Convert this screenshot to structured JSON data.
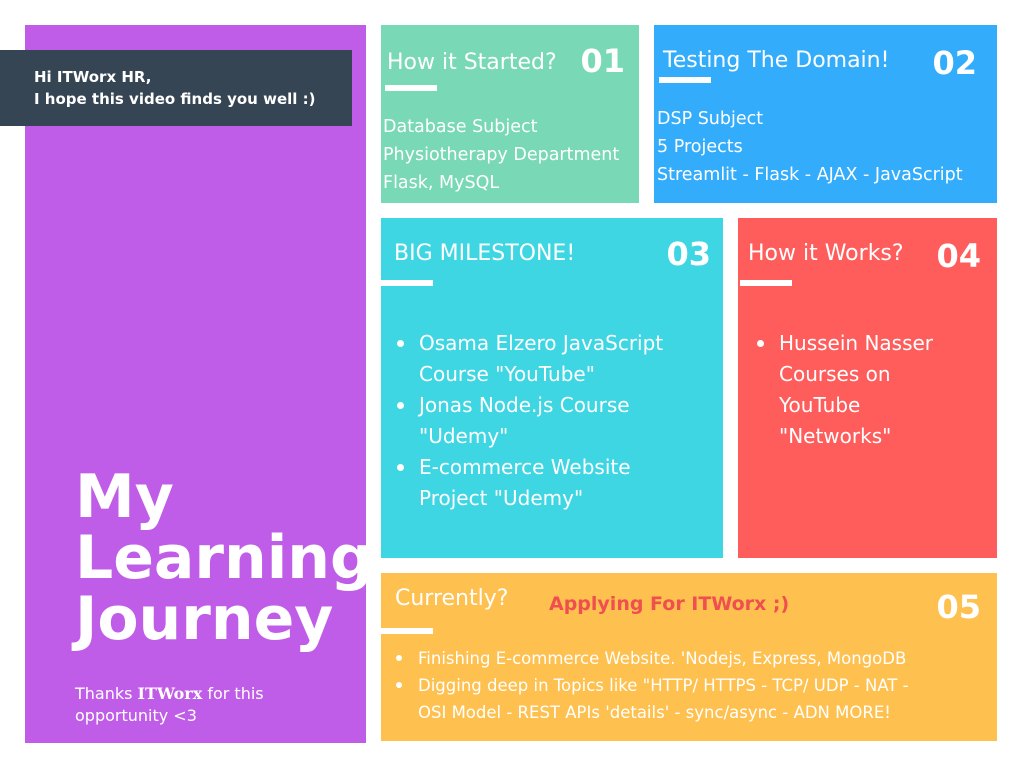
{
  "greeting": {
    "line1": "Hi ITWorx HR,",
    "line2": "I hope this video finds you well :)"
  },
  "left": {
    "title_lines": [
      "My",
      "Learning",
      "Journey"
    ],
    "thanks_prefix": "Thanks ",
    "thanks_brand": "ITWorx",
    "thanks_suffix": " for this",
    "thanks_line2": "opportunity <3",
    "bg": "#c05de8"
  },
  "panels": {
    "p1": {
      "title": "How it Started?",
      "number": "01",
      "lines": [
        "Database Subject",
        "Physiotherapy Department",
        "Flask, MySQL"
      ],
      "bg": "#79d8b6"
    },
    "p2": {
      "title": "Testing The Domain!",
      "number": "02",
      "lines": [
        "DSP Subject",
        "5 Projects",
        "Streamlit - Flask - AJAX - JavaScript"
      ],
      "bg": "#33adfb"
    },
    "p3": {
      "title": "BIG MILESTONE!",
      "number": "03",
      "items": [
        [
          "Osama Elzero JavaScript",
          "Course \"YouTube\""
        ],
        [
          "Jonas Node.js Course",
          "\"Udemy\""
        ],
        [
          "E-commerce Website",
          "Project \"Udemy\""
        ]
      ],
      "bg": "#3fd6e3"
    },
    "p4": {
      "title": "How it Works?",
      "number": "04",
      "items": [
        [
          "Hussein Nasser",
          "Courses on",
          "YouTube",
          "\"Networks\""
        ]
      ],
      "bg": "#fe5d5c"
    },
    "p5": {
      "title": "Currently?",
      "highlight": "Applying For ITWorx ;)",
      "number": "05",
      "items": [
        [
          "Finishing E-commerce Website. 'Nodejs, Express, MongoDB"
        ],
        [
          "Digging deep in Topics like \"HTTP/ HTTPS - TCP/ UDP - NAT -",
          "OSI Model - REST APIs 'details' - sync/async - ADN MORE!"
        ]
      ],
      "bg": "#fec04f"
    }
  }
}
